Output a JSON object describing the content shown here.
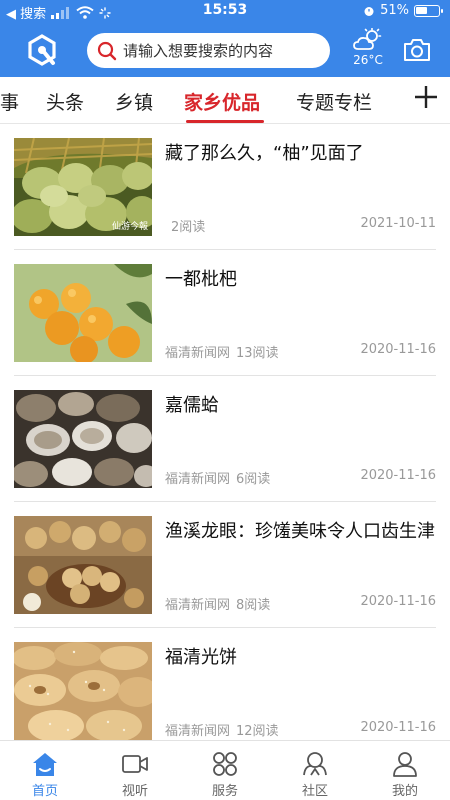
{
  "status_bar": {
    "back_label": "◀ 搜索",
    "time": "15:53",
    "battery": "51%",
    "battery_level": 0.51
  },
  "header": {
    "search_placeholder": "请输入想要搜索的内容",
    "weather_temp": "26°C",
    "accent_color": "#3a86e8"
  },
  "tabs": {
    "items": [
      "事",
      "头条",
      "乡镇",
      "家乡优品",
      "专题专栏"
    ],
    "active_index": 3,
    "active_color": "#d8262b"
  },
  "articles": [
    {
      "title": "藏了那么久，“柚”见面了",
      "source": "",
      "reads": "2阅读",
      "date": "2021-10-11",
      "watermark": "仙游今報"
    },
    {
      "title": "一都枇杷",
      "source": "福清新闻网",
      "reads": "13阅读",
      "date": "2020-11-16"
    },
    {
      "title": "嘉儒蛤",
      "source": "福清新闻网",
      "reads": "6阅读",
      "date": "2020-11-16"
    },
    {
      "title": "渔溪龙眼：珍馐美味令人口齿生津",
      "source": "福清新闻网",
      "reads": "8阅读",
      "date": "2020-11-16"
    },
    {
      "title": "福清光饼",
      "source": "福清新闻网",
      "reads": "12阅读",
      "date": "2020-11-16"
    }
  ],
  "bottom_nav": {
    "items": [
      {
        "label": "首页",
        "icon": "home-icon"
      },
      {
        "label": "视听",
        "icon": "video-icon"
      },
      {
        "label": "服务",
        "icon": "services-icon"
      },
      {
        "label": "社区",
        "icon": "community-icon"
      },
      {
        "label": "我的",
        "icon": "profile-icon"
      }
    ],
    "active_index": 0
  }
}
